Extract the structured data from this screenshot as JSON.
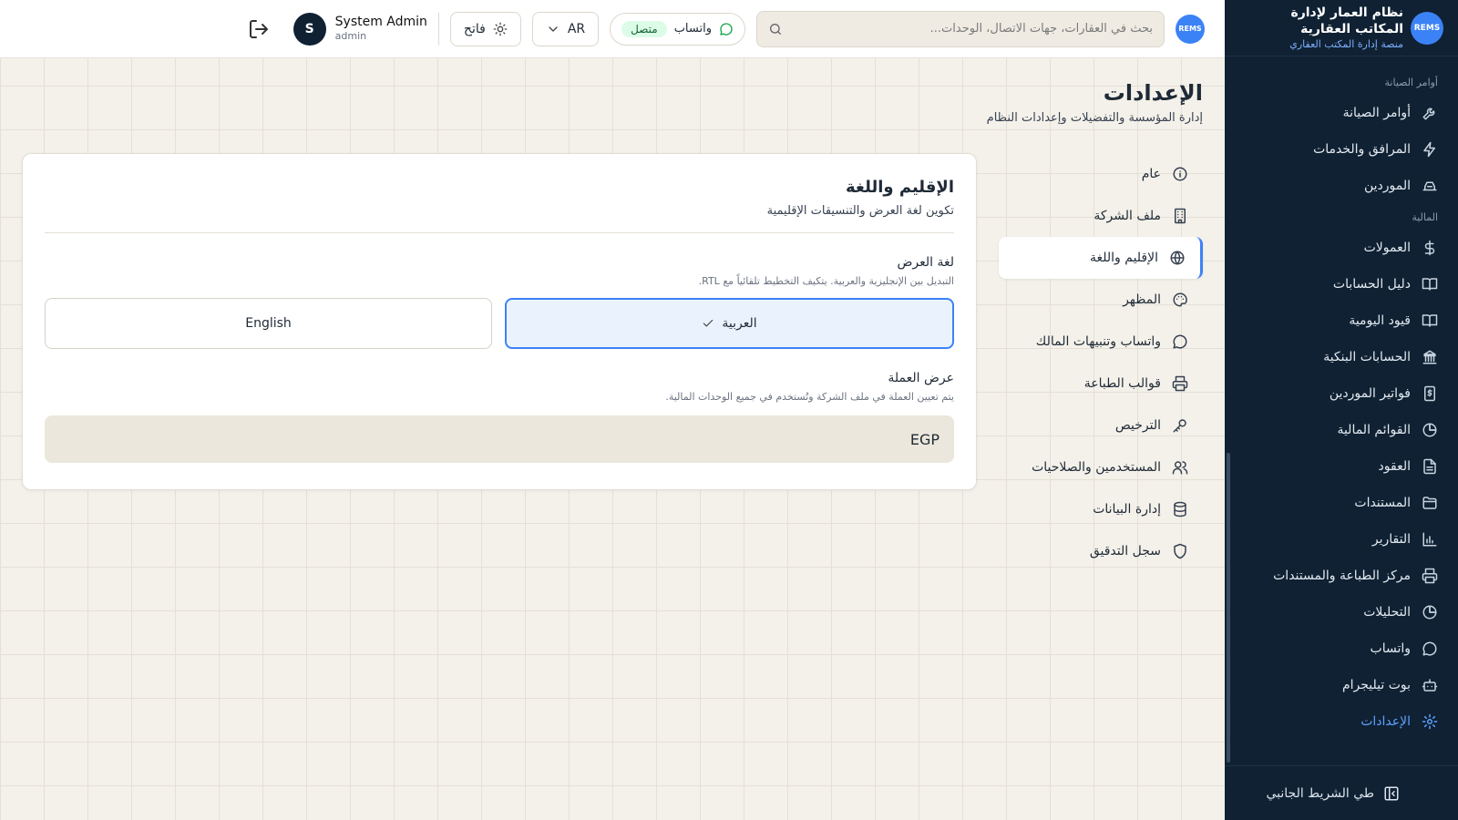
{
  "brand": {
    "logo_text": "REMS",
    "title": "نظام العمار لإدارة المكاتب العقارية",
    "subtitle": "منصة إدارة المكتب العقاري"
  },
  "sidebar": {
    "sections": [
      {
        "label": "أوامر الصيانة",
        "items": [
          {
            "label": "أوامر الصيانة",
            "icon": "wrench-icon"
          },
          {
            "label": "المرافق والخدمات",
            "icon": "bolt-icon"
          },
          {
            "label": "الموردين",
            "icon": "truck-icon"
          }
        ]
      },
      {
        "label": "المالية",
        "items": [
          {
            "label": "العمولات",
            "icon": "dollar-icon"
          },
          {
            "label": "دليل الحسابات",
            "icon": "book-icon"
          },
          {
            "label": "قيود اليومية",
            "icon": "book-open-icon"
          },
          {
            "label": "الحسابات البنكية",
            "icon": "bank-icon"
          },
          {
            "label": "فواتير الموردين",
            "icon": "invoice-icon"
          },
          {
            "label": "القوائم المالية",
            "icon": "pie-chart-icon"
          },
          {
            "label": "العقود",
            "icon": "file-icon"
          },
          {
            "label": "المستندات",
            "icon": "folder-icon"
          },
          {
            "label": "التقارير",
            "icon": "bar-chart-icon"
          },
          {
            "label": "مركز الطباعة والمستندات",
            "icon": "printer-icon"
          },
          {
            "label": "التحليلات",
            "icon": "pie-chart-icon"
          },
          {
            "label": "واتساب",
            "icon": "message-icon"
          },
          {
            "label": "بوت تيليجرام",
            "icon": "bot-icon"
          },
          {
            "label": "الإعدادات",
            "icon": "gear-icon",
            "active": true
          }
        ]
      }
    ],
    "collapse_label": "طي الشريط الجانبي"
  },
  "header": {
    "logo_text": "REMS",
    "search_placeholder": "بحث في العقارات، جهات الاتصال، الوحدات...",
    "whatsapp_label": "واتساب",
    "whatsapp_status": "متصل",
    "language": "AR",
    "theme_label": "فاتح",
    "user_name": "System Admin",
    "user_role": "admin",
    "avatar_initial": "S"
  },
  "page": {
    "title": "الإعدادات",
    "subtitle": "إدارة المؤسسة والتفضيلات وإعدادات النظام"
  },
  "settings_nav": [
    {
      "label": "عام",
      "icon": "info-icon"
    },
    {
      "label": "ملف الشركة",
      "icon": "building-icon"
    },
    {
      "label": "الإقليم واللغة",
      "icon": "globe-icon",
      "active": true
    },
    {
      "label": "المظهر",
      "icon": "palette-icon"
    },
    {
      "label": "واتساب وتنبيهات المالك",
      "icon": "message-icon"
    },
    {
      "label": "قوالب الطباعة",
      "icon": "printer-icon"
    },
    {
      "label": "الترخيص",
      "icon": "key-icon"
    },
    {
      "label": "المستخدمين والصلاحيات",
      "icon": "users-icon"
    },
    {
      "label": "إدارة البيانات",
      "icon": "database-icon"
    },
    {
      "label": "سجل التدقيق",
      "icon": "shield-icon"
    }
  ],
  "region": {
    "title": "الإقليم واللغة",
    "subtitle": "تكوين لغة العرض والتنسيقات الإقليمية",
    "language_label": "لغة العرض",
    "language_help": "التبديل بين الإنجليزية والعربية. يتكيف التخطيط تلقائياً مع RTL.",
    "options": [
      {
        "label": "العربية",
        "selected": true
      },
      {
        "label": "English",
        "selected": false
      }
    ],
    "currency_label": "عرض العملة",
    "currency_help": "يتم تعيين العملة في ملف الشركة وتُستخدم في جميع الوحدات المالية.",
    "currency_value": "EGP"
  },
  "colors": {
    "sidebar_bg": "#0f2133",
    "accent": "#3b82f6",
    "page_bg": "#f4f1ea",
    "status_green": "#16a34a"
  }
}
